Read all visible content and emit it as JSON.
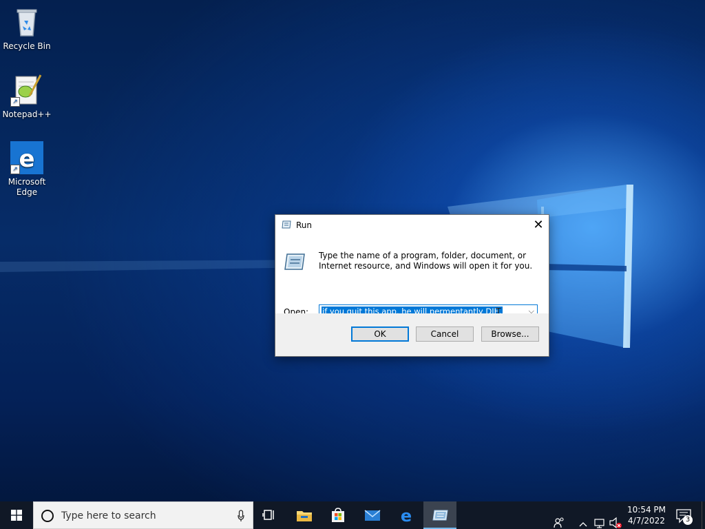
{
  "desktop": {
    "icons": [
      {
        "label": "Recycle Bin",
        "icon": "recycle-bin-icon"
      },
      {
        "label": "Notepad++",
        "icon": "notepad-plus-plus-icon"
      },
      {
        "label": "Microsoft Edge",
        "icon": "edge-icon"
      }
    ]
  },
  "run_dialog": {
    "title": "Run",
    "close_glyph": "✕",
    "description": "Type the name of a program, folder, document, or Internet resource, and Windows will open it for you.",
    "open_label": "Open:",
    "open_value": "if you quit this app, he will permentantly DIE.",
    "dropdown_glyph": "⌵",
    "buttons": {
      "ok": "OK",
      "cancel": "Cancel",
      "browse": "Browse..."
    }
  },
  "taskbar": {
    "search_placeholder": "Type here to search",
    "pinned": [
      "task-view-icon",
      "file-explorer-icon",
      "store-icon",
      "mail-icon",
      "edge-icon",
      "run-icon"
    ],
    "clock": {
      "time": "10:54 PM",
      "date": "4/7/2022"
    },
    "notification_count": "3",
    "accent": "#0078d7"
  }
}
